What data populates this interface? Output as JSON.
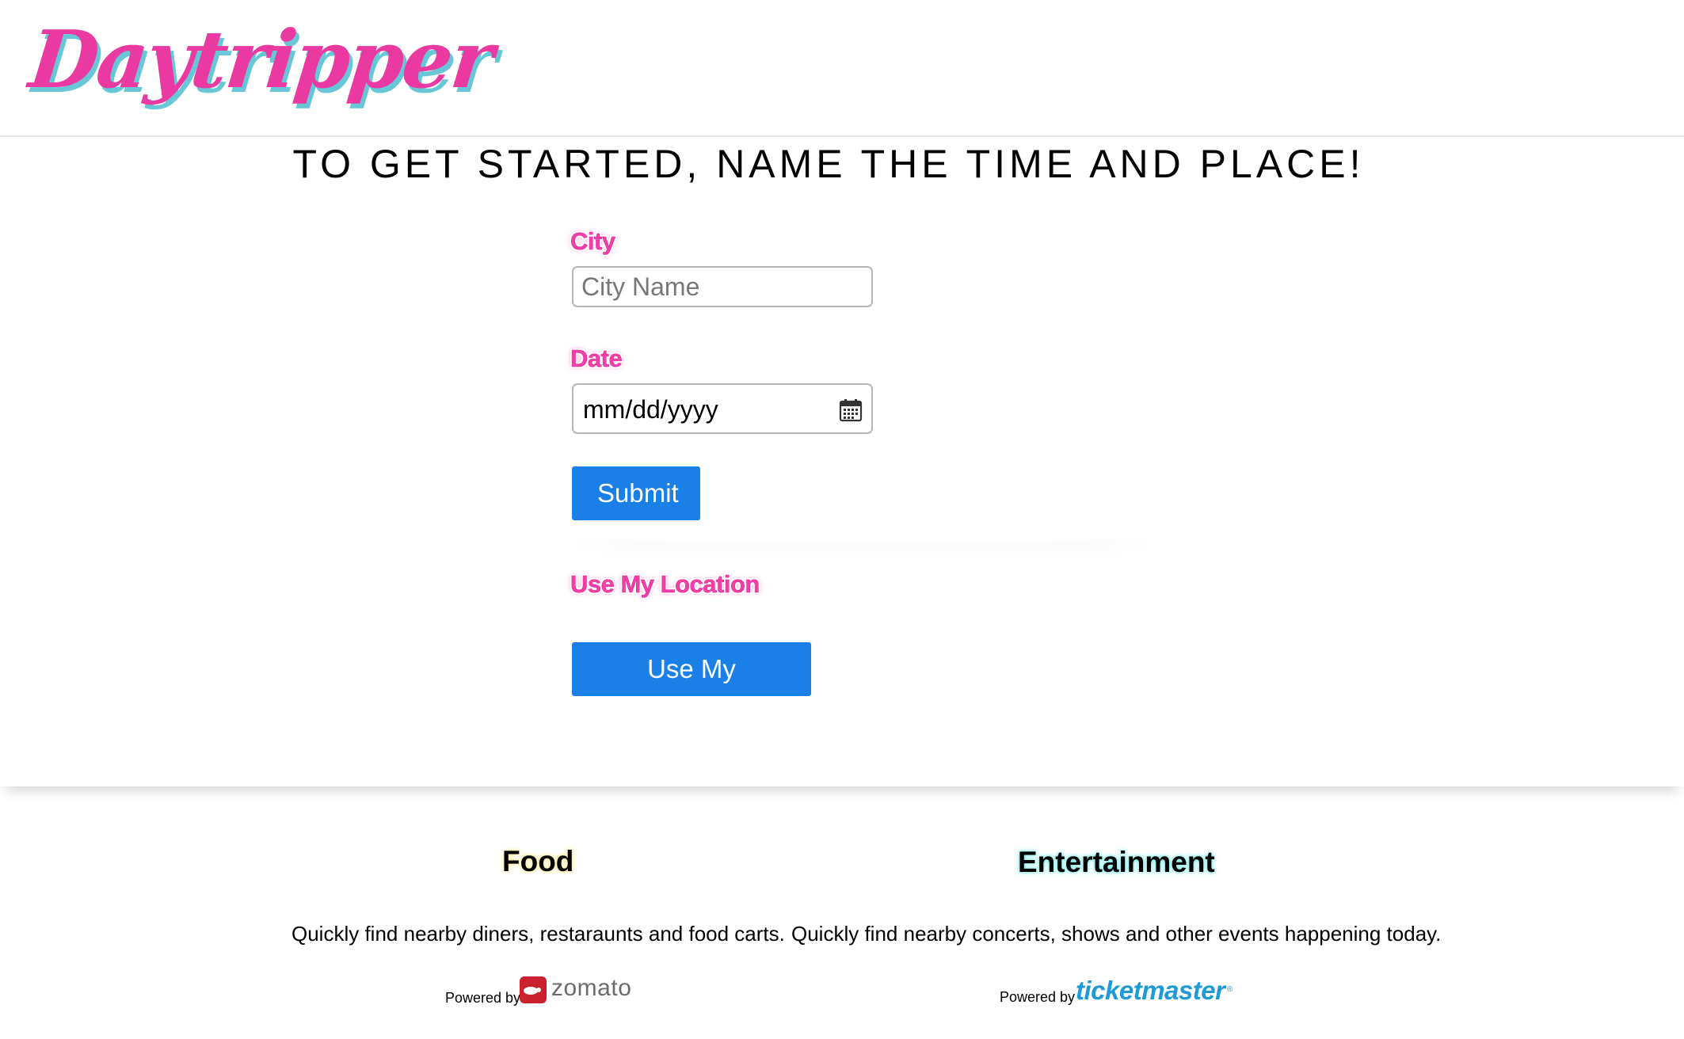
{
  "header": {
    "logo_text": "Daytripper"
  },
  "main": {
    "headline": "TO GET STARTED, NAME THE TIME AND PLACE!",
    "city_label": "City",
    "city_placeholder": "City Name",
    "city_value": "",
    "date_label": "Date",
    "date_value": "mm/dd/yyyy",
    "submit_label": "Submit",
    "location_label": "Use My Location",
    "location_button_label": "Use My Location"
  },
  "features": {
    "food": {
      "title": "Food",
      "description": "Quickly find nearby diners, restaraunts and food carts.",
      "powered_by": "Powered by",
      "brand": "zomato"
    },
    "entertainment": {
      "title": "Entertainment",
      "description": "Quickly find nearby concerts, shows and other events happening today.",
      "powered_by": "Powered by",
      "brand": "ticketmaster",
      "brand_mark": "®"
    }
  },
  "colors": {
    "logo_pink": "#ea3aa2",
    "logo_shadow_teal": "#67c7d6",
    "label_pink": "#f03fa6",
    "button_blue": "#1a7fe6",
    "food_glow": "#ffe487",
    "entertainment_glow": "#67e0e0",
    "zomato_red": "#cb202d",
    "ticketmaster_blue": "#1e9bd7"
  },
  "icons": {
    "date_picker": "calendar-icon",
    "zomato": "zomato-logo-icon"
  }
}
